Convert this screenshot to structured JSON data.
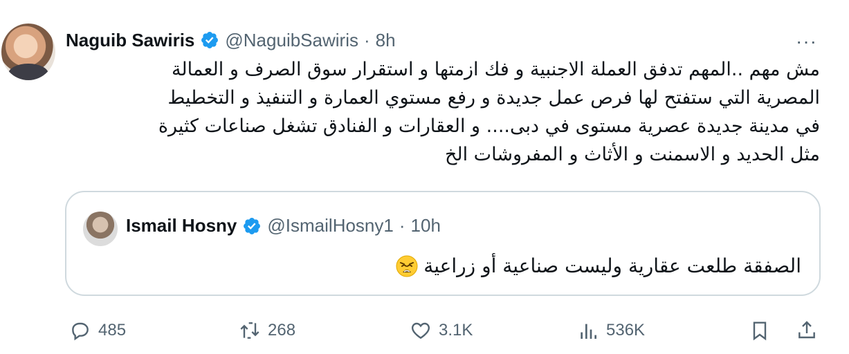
{
  "tweet": {
    "author_name": "Naguib Sawiris",
    "handle": "@NaguibSawiris",
    "separator": "·",
    "time": "8h",
    "more_label": "···",
    "text_lines": [
      "مش مهم ..المهم تدفق العملة الاجنبية و فك ازمتها و استقرار سوق الصرف و العمالة",
      "المصرية التي ستفتح لها فرص عمل جديدة  و رفع مستوي العمارة و التنفيذ و التخطيط",
      "في مدينة جديدة عصرية مستوى في دبى.... و العقارات و الفنادق تشغل صناعات كثيرة",
      "مثل الحديد و الاسمنت و الأثاث و المفروشات الخ"
    ]
  },
  "quoted_tweet": {
    "author_name": "Ismail Hosny",
    "handle": "@IsmailHosny1",
    "separator": "·",
    "time": "10h",
    "text": "الصفقة طلعت عقارية وليست صناعية أو زراعية",
    "emoji": "weary-face-emoji"
  },
  "actions": {
    "replies": "485",
    "retweets": "268",
    "likes": "3.1K",
    "views": "536K"
  },
  "colors": {
    "verified_blue": "#1d9bf0",
    "secondary_text": "#536471",
    "border": "#cfd9de"
  }
}
